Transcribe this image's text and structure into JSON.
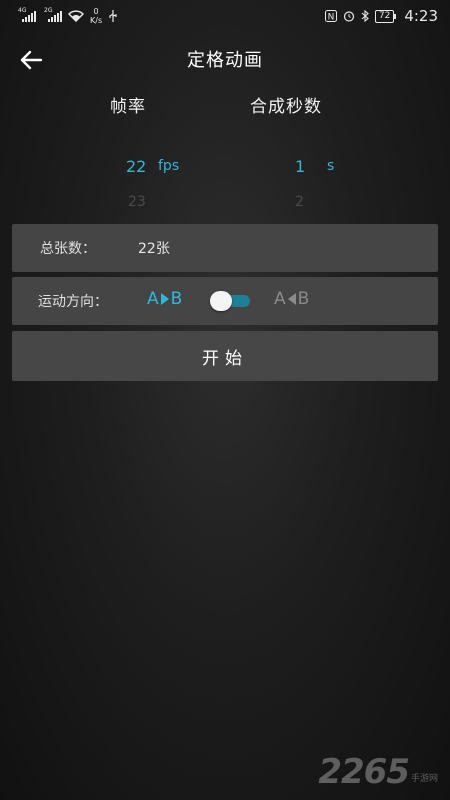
{
  "status_bar": {
    "signal1": "4G",
    "signal2": "2G",
    "net_speed_value": "0",
    "net_speed_unit": "K/s",
    "battery": "72",
    "time": "4:23",
    "icons": [
      "signal-icon",
      "wifi-icon",
      "usb-icon",
      "nfc-icon",
      "alarm-icon",
      "bluetooth-icon",
      "battery-icon"
    ]
  },
  "header": {
    "title": "定格动画",
    "back_icon": "arrow-left-icon"
  },
  "pickers": {
    "fps_label": "帧率",
    "seconds_label": "合成秒数",
    "fps_selected": "22",
    "fps_unit": "fps",
    "fps_next": "23",
    "seconds_selected": "1",
    "seconds_unit": "s",
    "seconds_next": "2"
  },
  "total": {
    "label": "总张数：",
    "value": "22张"
  },
  "direction": {
    "label": "运动方向：",
    "option_ab_a": "A",
    "option_ab_b": "B",
    "option_ba_a": "A",
    "option_ba_b": "B",
    "toggle_on": false
  },
  "start_button": {
    "label": "开始"
  },
  "watermark": {
    "number": "2265",
    "sub": "手游网"
  },
  "colors": {
    "accent": "#2fb8dc",
    "panel": "#454545",
    "background": "#1e1e1e"
  }
}
